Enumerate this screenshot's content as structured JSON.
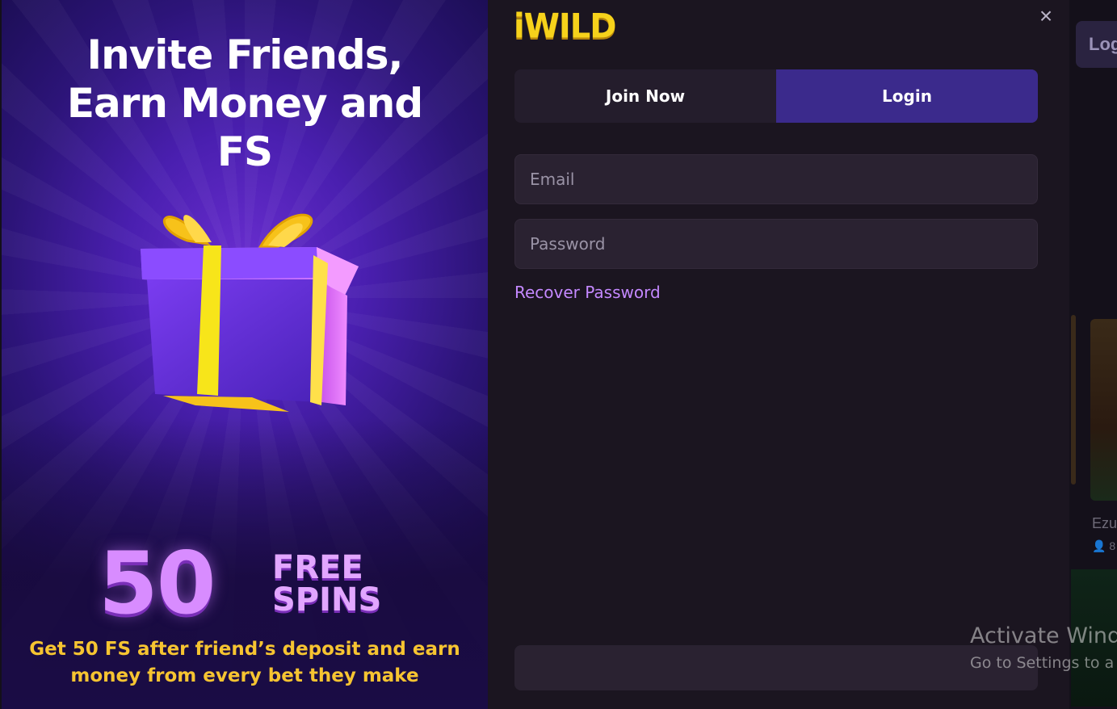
{
  "background": {
    "login_button": "Log",
    "game_title": "Ezu",
    "game_meta": "👤 8"
  },
  "promo": {
    "title_line1": "Invite Friends,",
    "title_line2": "Earn Money and",
    "title_line3": "FS",
    "spins_number": "50",
    "spins_free": "FREE",
    "spins_word": "SPINS",
    "description_line1": "Get 50 FS after friend’s deposit and earn",
    "description_line2": "money from every bet they make"
  },
  "header": {
    "logo": "iWILD",
    "close_icon": "×"
  },
  "tabs": {
    "join": "Join Now",
    "login": "Login",
    "active": "login"
  },
  "form": {
    "email_placeholder": "Email",
    "password_placeholder": "Password",
    "recover_link": "Recover Password",
    "submit_label": ""
  },
  "os_overlay": {
    "line1": "Activate Wind",
    "line2": "Go to Settings to a"
  },
  "colors": {
    "accent_tab": "#3b2a8c",
    "link": "#c488ff",
    "logo": "#f6d21b",
    "promo_text": "#f6c431"
  }
}
